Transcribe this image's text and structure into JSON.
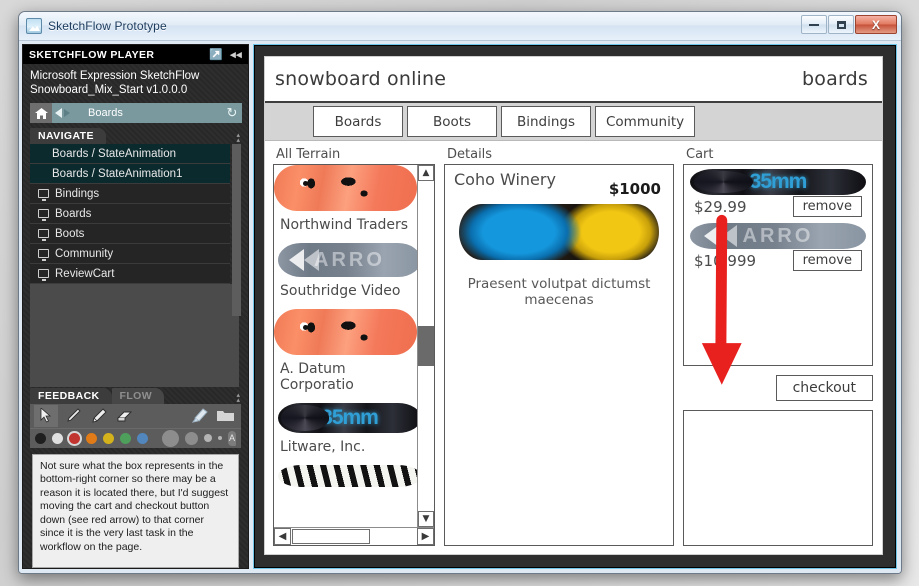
{
  "window": {
    "title": "SketchFlow Prototype",
    "app_icon": "sketchflow-icon",
    "controls": {
      "minimize": "minimize",
      "maximize": "maximize",
      "close": "X"
    }
  },
  "player": {
    "header_title": "SKETCHFLOW PLAYER",
    "popout_icon": "popout-icon",
    "collapse_icon": "collapse-icon",
    "info_line1": "Microsoft Expression SketchFlow",
    "info_line2": "Snowboard_Mix_Start v1.0.0.0",
    "navbar": {
      "home_icon": "home-icon",
      "back_icon": "back-arrow-icon",
      "forward_icon": "forward-arrow-icon",
      "breadcrumb": "Boards",
      "refresh_icon": "refresh-icon"
    },
    "navigate_tab": "NAVIGATE",
    "nav_items": [
      {
        "label": "Boards / StateAnimation",
        "type": "state"
      },
      {
        "label": "Boards / StateAnimation1",
        "type": "state"
      },
      {
        "label": "Bindings",
        "type": "screen"
      },
      {
        "label": "Boards",
        "type": "screen"
      },
      {
        "label": "Boots",
        "type": "screen"
      },
      {
        "label": "Community",
        "type": "screen"
      },
      {
        "label": "ReviewCart",
        "type": "screen"
      }
    ]
  },
  "feedback": {
    "tab_active": "FEEDBACK",
    "tab_inactive": "FLOW",
    "tools": [
      {
        "name": "select-tool",
        "glyph": "➤",
        "selected": true
      },
      {
        "name": "brush-tool",
        "glyph": "╱",
        "selected": false
      },
      {
        "name": "pencil-tool",
        "glyph": "╱",
        "selected": false
      },
      {
        "name": "eraser-tool",
        "glyph": "▱",
        "selected": false
      },
      {
        "name": "clear-ink-tool",
        "glyph": "✂",
        "selected": false
      },
      {
        "name": "folder-tool",
        "glyph": "▭",
        "selected": false
      }
    ],
    "colors": [
      {
        "name": "black",
        "hex": "#1f1f1f",
        "selected": false
      },
      {
        "name": "white",
        "hex": "#e0e0e0",
        "selected": false
      },
      {
        "name": "red",
        "hex": "#c2342f",
        "selected": true
      },
      {
        "name": "orange",
        "hex": "#e07b18",
        "selected": false
      },
      {
        "name": "yellow",
        "hex": "#d4b21c",
        "selected": false
      },
      {
        "name": "green",
        "hex": "#4f9f5c",
        "selected": false
      },
      {
        "name": "blue",
        "hex": "#5187bd",
        "selected": false
      }
    ],
    "sizes": [
      18,
      14,
      8,
      4
    ],
    "text_tool_glyph": "A",
    "note_text": "Not sure what the box represents in the bottom-right corner so there may be a reason it is located there, but I'd suggest moving the cart and checkout button down (see red arrow) to that corner since it is the very last task in the workflow on the page."
  },
  "prototype": {
    "title": "snowboard online",
    "page_label": "boards",
    "tabs": [
      {
        "label": "Boards"
      },
      {
        "label": "Boots"
      },
      {
        "label": "Bindings"
      },
      {
        "label": "Community"
      }
    ],
    "list_column": {
      "label": "All Terrain",
      "items": [
        {
          "name": "Northwind Traders",
          "board": "orange"
        },
        {
          "name": "Southridge Video",
          "board": "carbon"
        },
        {
          "name": "A. Datum Corporatio",
          "board": "orange"
        },
        {
          "name": "Litware, Inc.",
          "board": "camera"
        },
        {
          "name": "",
          "board": "zebra"
        }
      ],
      "scroll_up_icon": "chevron-up-icon",
      "scroll_down_icon": "chevron-down-icon",
      "scroll_left_icon": "chevron-left-icon",
      "scroll_right_icon": "chevron-right-icon"
    },
    "detail_column": {
      "label": "Details",
      "product_name": "Coho Winery",
      "price": "$1000",
      "board": "butterfly",
      "description": "Praesent volutpat dictumst maecenas"
    },
    "cart_column": {
      "label": "Cart",
      "items": [
        {
          "price": "$29.99",
          "remove_label": "remove",
          "board": "camera"
        },
        {
          "price": "$10,999",
          "remove_label": "remove",
          "board": "carbon"
        }
      ],
      "checkout_label": "checkout",
      "empty_box": "empty-placeholder-box"
    },
    "annotation": {
      "type": "red-arrow",
      "color": "#e8211f"
    }
  }
}
